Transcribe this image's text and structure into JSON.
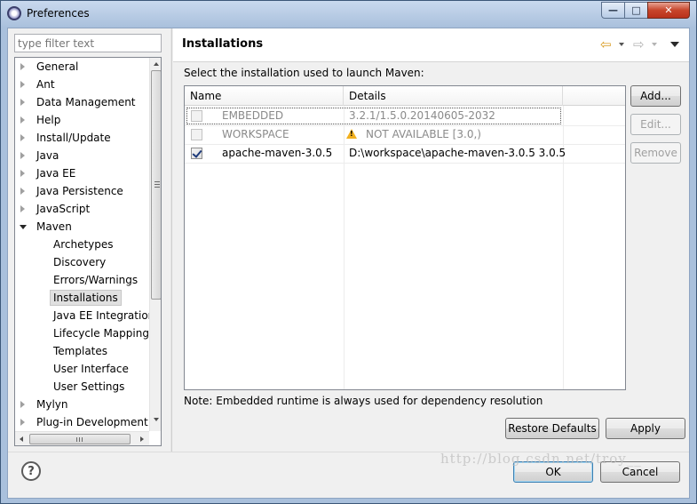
{
  "window": {
    "title": "Preferences",
    "buttons": {
      "minimize": "—",
      "maximize": "□",
      "close": "✕"
    }
  },
  "filter": {
    "placeholder": "type filter text"
  },
  "tree": {
    "items": [
      {
        "label": "General",
        "state": "collapsed"
      },
      {
        "label": "Ant",
        "state": "collapsed"
      },
      {
        "label": "Data Management",
        "state": "collapsed"
      },
      {
        "label": "Help",
        "state": "collapsed"
      },
      {
        "label": "Install/Update",
        "state": "collapsed"
      },
      {
        "label": "Java",
        "state": "collapsed"
      },
      {
        "label": "Java EE",
        "state": "collapsed"
      },
      {
        "label": "Java Persistence",
        "state": "collapsed"
      },
      {
        "label": "JavaScript",
        "state": "collapsed"
      },
      {
        "label": "Maven",
        "state": "expanded"
      },
      {
        "label": "Archetypes",
        "child": true
      },
      {
        "label": "Discovery",
        "child": true
      },
      {
        "label": "Errors/Warnings",
        "child": true
      },
      {
        "label": "Installations",
        "child": true,
        "selected": true
      },
      {
        "label": "Java EE Integration",
        "child": true
      },
      {
        "label": "Lifecycle Mapping",
        "child": true
      },
      {
        "label": "Templates",
        "child": true
      },
      {
        "label": "User Interface",
        "child": true
      },
      {
        "label": "User Settings",
        "child": true
      },
      {
        "label": "Mylyn",
        "state": "collapsed"
      },
      {
        "label": "Plug-in Development",
        "state": "collapsed"
      }
    ],
    "hscroll_grip": "III"
  },
  "page": {
    "title": "Installations",
    "nav_back_icon": "arrow-left-icon",
    "nav_forward_icon": "arrow-right-icon",
    "intro": "Select the installation used to launch Maven:",
    "table": {
      "columns": [
        "Name",
        "Details"
      ],
      "rows": [
        {
          "checked": false,
          "enabled": false,
          "name": "EMBEDDED",
          "details": "3.2.1/1.5.0.20140605-2032",
          "warning": false
        },
        {
          "checked": false,
          "enabled": false,
          "name": "WORKSPACE",
          "details": "NOT AVAILABLE [3.0,)",
          "warning": true
        },
        {
          "checked": true,
          "enabled": true,
          "name": "apache-maven-3.0.5",
          "details": "D:\\workspace\\apache-maven-3.0.5 3.0.5",
          "warning": false
        }
      ]
    },
    "side_buttons": {
      "add": "Add...",
      "edit": "Edit...",
      "remove": "Remove"
    },
    "note": "Note: Embedded runtime is always used for dependency resolution",
    "restore_defaults": "Restore Defaults",
    "apply": "Apply"
  },
  "footer": {
    "help": "?",
    "ok": "OK",
    "cancel": "Cancel"
  },
  "watermark": "http://blog.csdn.net/troy__",
  "colors": {
    "accent": "#3c7fb1",
    "warning": "#f2b01e",
    "back_arrow": "#d89a1e"
  }
}
